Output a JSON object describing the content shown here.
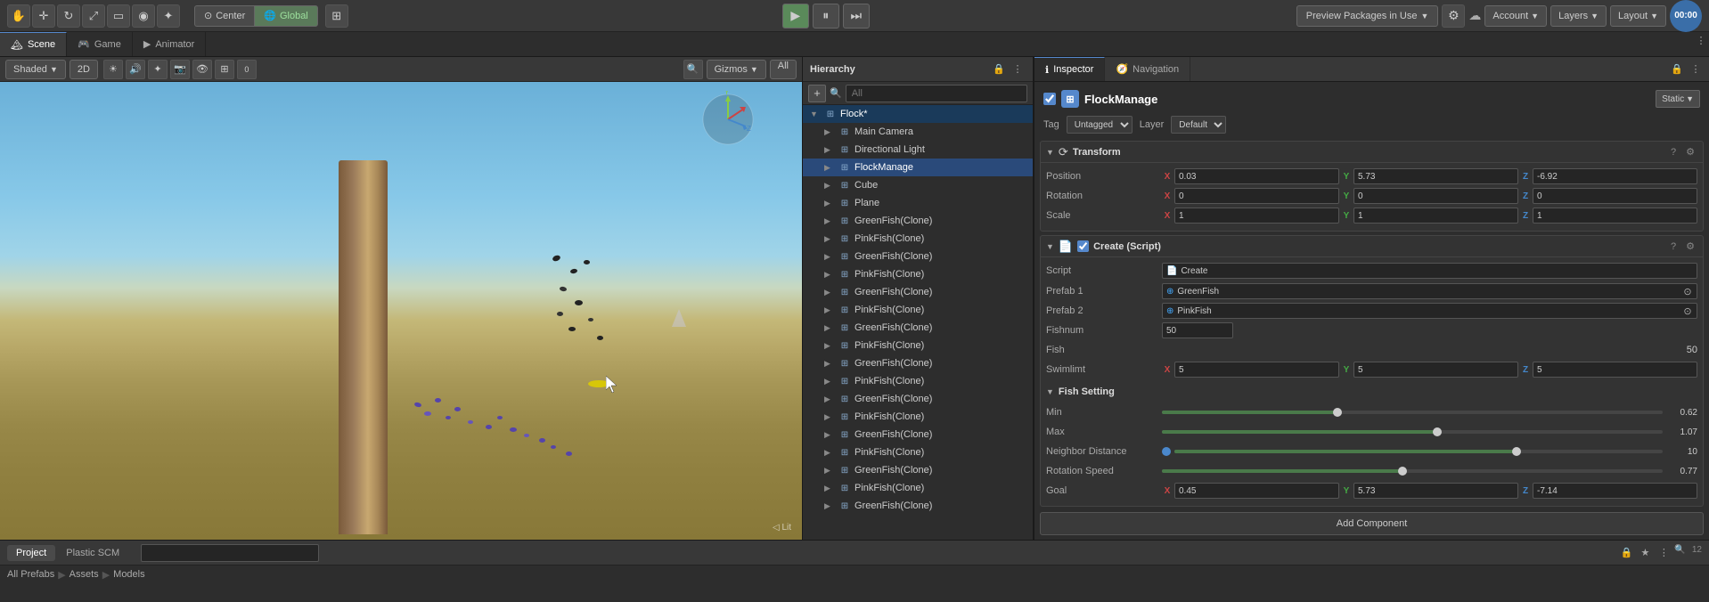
{
  "toolbar": {
    "pivot_label": "Center",
    "global_label": "Global",
    "play_title": "Play",
    "pause_title": "Pause",
    "step_title": "Step",
    "preview_packages": "Preview Packages in Use",
    "account_label": "Account",
    "layers_label": "Layers",
    "layout_label": "Layout",
    "timer": "00:00"
  },
  "tabs": {
    "scene_label": "Scene",
    "game_label": "Game",
    "animator_label": "Animator"
  },
  "scene_view": {
    "shaded_label": "Shaded",
    "twod_label": "2D",
    "gizmos_label": "Gizmos",
    "all_label": "All"
  },
  "hierarchy": {
    "title": "Hierarchy",
    "search_placeholder": "All",
    "items": [
      {
        "id": "flock",
        "name": "Flock*",
        "indent": 0,
        "expanded": true,
        "selected": false
      },
      {
        "id": "main-camera",
        "name": "Main Camera",
        "indent": 1,
        "expanded": false,
        "selected": false
      },
      {
        "id": "dir-light",
        "name": "Directional Light",
        "indent": 1,
        "expanded": false,
        "selected": false
      },
      {
        "id": "flock-manage",
        "name": "FlockManage",
        "indent": 1,
        "expanded": false,
        "selected": true
      },
      {
        "id": "cube",
        "name": "Cube",
        "indent": 1,
        "expanded": false,
        "selected": false
      },
      {
        "id": "plane",
        "name": "Plane",
        "indent": 1,
        "expanded": false,
        "selected": false
      },
      {
        "id": "greenfish1",
        "name": "GreenFish(Clone)",
        "indent": 1,
        "expanded": false,
        "selected": false
      },
      {
        "id": "pinkfish1",
        "name": "PinkFish(Clone)",
        "indent": 1,
        "expanded": false,
        "selected": false
      },
      {
        "id": "greenfish2",
        "name": "GreenFish(Clone)",
        "indent": 1,
        "expanded": false,
        "selected": false
      },
      {
        "id": "pinkfish2",
        "name": "PinkFish(Clone)",
        "indent": 1,
        "expanded": false,
        "selected": false
      },
      {
        "id": "greenfish3",
        "name": "GreenFish(Clone)",
        "indent": 1,
        "expanded": false,
        "selected": false
      },
      {
        "id": "pinkfish3",
        "name": "PinkFish(Clone)",
        "indent": 1,
        "expanded": false,
        "selected": false
      },
      {
        "id": "greenfish4",
        "name": "GreenFish(Clone)",
        "indent": 1,
        "expanded": false,
        "selected": false
      },
      {
        "id": "pinkfish4",
        "name": "PinkFish(Clone)",
        "indent": 1,
        "expanded": false,
        "selected": false
      },
      {
        "id": "greenfish5",
        "name": "GreenFish(Clone)",
        "indent": 1,
        "expanded": false,
        "selected": false
      },
      {
        "id": "pinkfish5",
        "name": "PinkFish(Clone)",
        "indent": 1,
        "expanded": false,
        "selected": false
      },
      {
        "id": "greenfish6",
        "name": "GreenFish(Clone)",
        "indent": 1,
        "expanded": false,
        "selected": false
      },
      {
        "id": "pinkfish6",
        "name": "PinkFish(Clone)",
        "indent": 1,
        "expanded": false,
        "selected": false
      },
      {
        "id": "greenfish7",
        "name": "GreenFish(Clone)",
        "indent": 1,
        "expanded": false,
        "selected": false
      },
      {
        "id": "pinkfish7",
        "name": "PinkFish(Clone)",
        "indent": 1,
        "expanded": false,
        "selected": false
      },
      {
        "id": "greenfish8",
        "name": "GreenFish(Clone)",
        "indent": 1,
        "expanded": false,
        "selected": false
      },
      {
        "id": "pinkfish8",
        "name": "PinkFish(Clone)",
        "indent": 1,
        "expanded": false,
        "selected": false
      },
      {
        "id": "greenfish9",
        "name": "GreenFish(Clone)",
        "indent": 1,
        "expanded": false,
        "selected": false
      }
    ]
  },
  "inspector": {
    "title": "Inspector",
    "navigation_label": "Navigation",
    "object_name": "FlockManage",
    "tag_label": "Tag",
    "tag_value": "Untagged",
    "layer_label": "Layer",
    "layer_value": "Default",
    "static_label": "Static",
    "transform": {
      "title": "Transform",
      "position_label": "Position",
      "pos_x": "0.03",
      "pos_y": "5.73",
      "pos_z": "-6.92",
      "rotation_label": "Rotation",
      "rot_x": "0",
      "rot_y": "0",
      "rot_z": "0",
      "scale_label": "Scale",
      "scale_x": "1",
      "scale_y": "1",
      "scale_z": "1"
    },
    "create_script": {
      "title": "Create (Script)",
      "script_label": "Script",
      "script_value": "Create",
      "prefab1_label": "Prefab 1",
      "prefab1_value": "GreenFish",
      "prefab2_label": "Prefab 2",
      "prefab2_value": "PinkFish",
      "fishnum_label": "Fishnum",
      "fishnum_value": "50",
      "fish_label": "Fish",
      "fish_value": "50",
      "swimlimt_label": "Swimlimt",
      "swim_x": "5",
      "swim_y": "5",
      "swim_z": "5",
      "fish_setting_title": "Fish Setting",
      "min_label": "Min",
      "min_value": "0.62",
      "min_pct": 35,
      "max_label": "Max",
      "max_value": "1.07",
      "max_pct": 55,
      "neighbor_label": "Neighbor Distance",
      "neighbor_value": "10",
      "neighbor_pct": 70,
      "rotation_speed_label": "Rotation Speed",
      "rotation_value": "0.77",
      "rotation_pct": 48,
      "goal_label": "Goal",
      "goal_x": "0.45",
      "goal_y": "5.73",
      "goal_z": "-7.14"
    },
    "add_component_label": "Add Component"
  },
  "bottom": {
    "project_label": "Project",
    "plastic_label": "Plastic SCM",
    "search_placeholder": "",
    "breadcrumb": {
      "all": "All Prefabs",
      "arrow": "▶",
      "assets": "Assets",
      "models": "Models"
    },
    "zoom": "12"
  }
}
